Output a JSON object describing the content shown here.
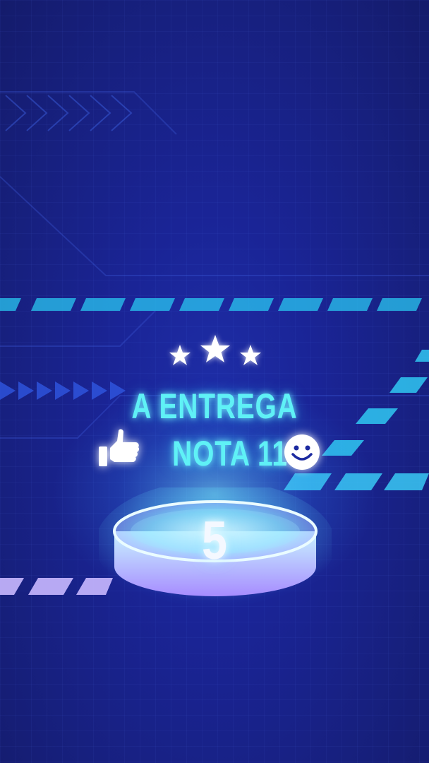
{
  "headline": {
    "line1": "A ENTREGA",
    "line2": "NOTA 11"
  },
  "rating_stars": 3,
  "podium_number": "5",
  "icons": [
    "star-icon",
    "thumbs-up-icon",
    "smiley-icon"
  ],
  "colors": {
    "background": "#1a2496",
    "headline": "#5ff1f6",
    "dash_cyan": "#29c7f0",
    "dash_lilac": "#c9b8ff",
    "podium_glow": "#66e6ff"
  }
}
